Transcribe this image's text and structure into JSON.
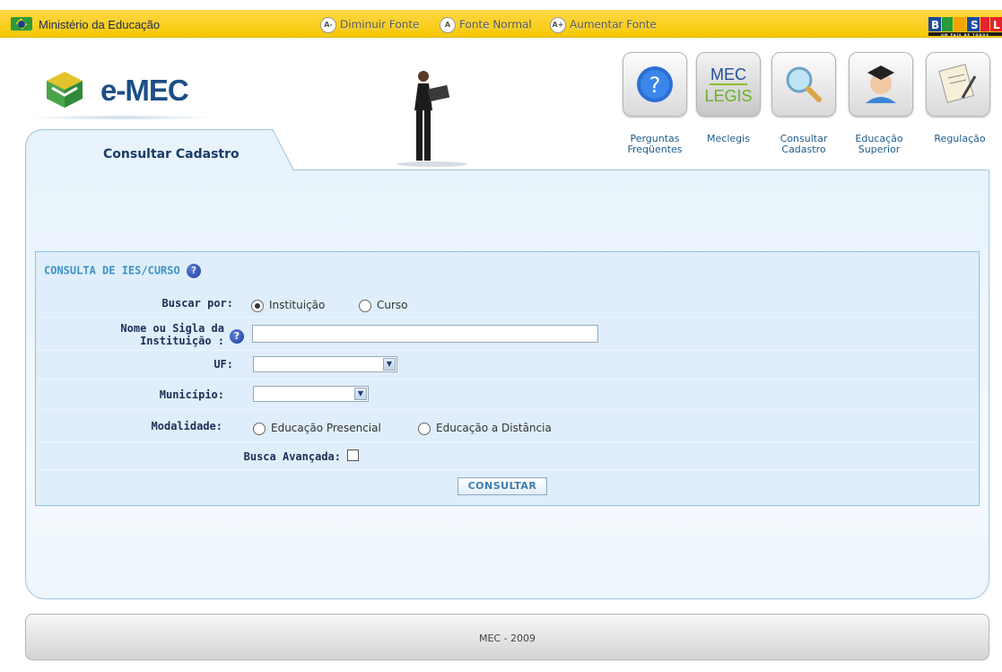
{
  "govbar": {
    "ministry": "Ministério da Educação",
    "decrease_font": {
      "symbol": "A-",
      "label": "Diminuir Fonte"
    },
    "normal_font": {
      "symbol": "A",
      "label": "Fonte Normal"
    },
    "increase_font": {
      "symbol": "A+",
      "label": "Aumentar Fonte"
    },
    "brasil_logo": "BRASIL",
    "brasil_tagline": "UM PAÍS DE TODOS"
  },
  "logo": {
    "text": "e-MEC"
  },
  "nav": {
    "items": [
      {
        "label_line1": "Perguntas",
        "label_line2": "Freqüentes",
        "icon": "question-icon"
      },
      {
        "label_line1": "Meclegis",
        "label_line2": "",
        "icon": "meclegis-icon",
        "icon_text_1": "MEC",
        "icon_text_2": "LEGIS"
      },
      {
        "label_line1": "Consultar",
        "label_line2": "Cadastro",
        "icon": "magnifier-icon"
      },
      {
        "label_line1": "Educação",
        "label_line2": "Superior",
        "icon": "graduate-icon"
      },
      {
        "label_line1": "Regulação",
        "label_line2": "",
        "icon": "document-icon"
      }
    ]
  },
  "tab": {
    "title": "Consultar Cadastro"
  },
  "form": {
    "title": "CONSULTA DE IES/CURSO",
    "help_symbol": "?",
    "buscar_por_label": "Buscar por:",
    "buscar_options": [
      "Instituição",
      "Curso"
    ],
    "buscar_selected": "Instituição",
    "nome_label_line1": "Nome ou Sigla da",
    "nome_label_line2": "Instituição :",
    "nome_value": "",
    "uf_label": "UF:",
    "uf_value": "",
    "municipio_label": "Município:",
    "municipio_value": "",
    "modalidade_label": "Modalidade:",
    "modalidade_options": [
      "Educação Presencial",
      "Educação a Distância"
    ],
    "busca_avancada_label": "Busca Avançada:",
    "busca_avancada_checked": false,
    "submit_label": "CONSULTAR",
    "dropdown_arrow": "▼"
  },
  "footer": {
    "text": "MEC - 2009"
  },
  "colors": {
    "govbar": "#f6c800",
    "brand_blue": "#1c4e86",
    "panel_bg": "#e8f3fb",
    "form_title": "#3b93c6"
  }
}
